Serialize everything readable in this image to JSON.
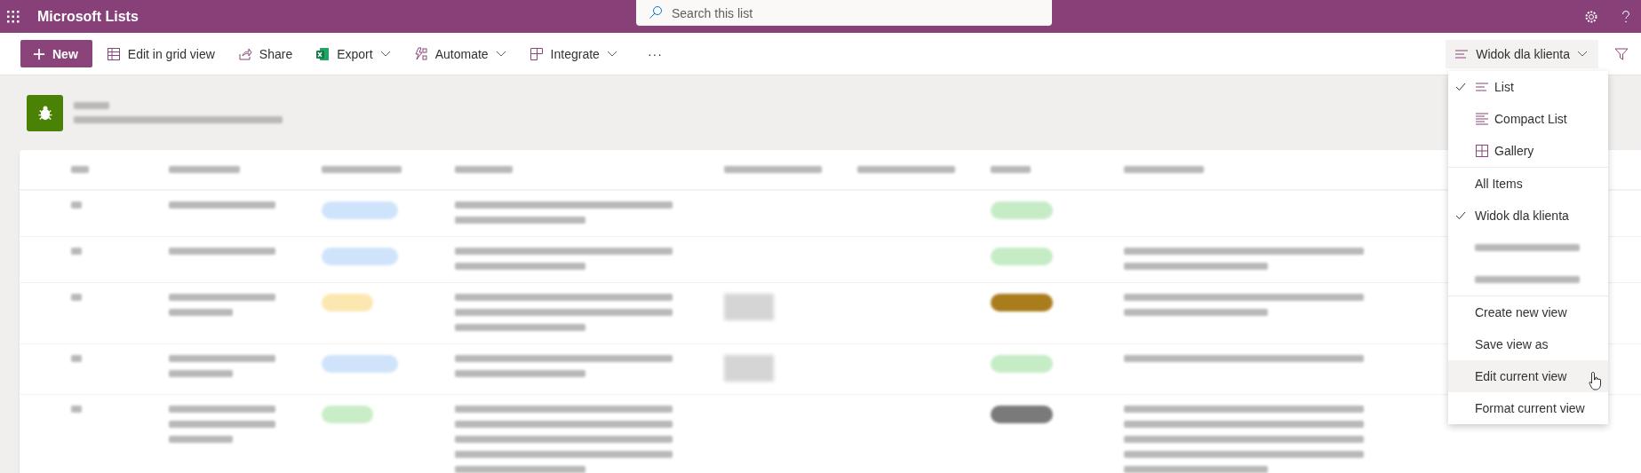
{
  "app_bar": {
    "title": "Microsoft Lists",
    "search": {
      "placeholder": "Search this list"
    }
  },
  "command_bar": {
    "commands": [
      {
        "label": "New",
        "kind": "new",
        "dropdown": false
      },
      {
        "label": "Edit in grid view",
        "kind": "grid",
        "dropdown": false
      },
      {
        "label": "Share",
        "kind": "share",
        "dropdown": false
      },
      {
        "label": "Export",
        "kind": "excel",
        "dropdown": true
      },
      {
        "label": "Automate",
        "kind": "automate",
        "dropdown": true
      },
      {
        "label": "Integrate",
        "kind": "integrate",
        "dropdown": true
      },
      {
        "label": "···",
        "kind": "more",
        "dropdown": false
      }
    ],
    "view_button": {
      "label": "Widok dla klienta"
    }
  },
  "view_menu": {
    "sections": [
      {
        "items": [
          {
            "label": "List",
            "kind": "list",
            "checked": true,
            "hovered": false
          },
          {
            "label": "Compact List",
            "kind": "compact",
            "checked": false,
            "hovered": false
          },
          {
            "label": "Gallery",
            "kind": "gallery",
            "checked": false,
            "hovered": false
          }
        ]
      },
      {
        "items": [
          {
            "label": "All Items",
            "kind": "view",
            "checked": false,
            "hovered": false
          },
          {
            "label": "Widok dla klienta",
            "kind": "view",
            "checked": true,
            "hovered": false
          },
          {
            "kind": "blurred",
            "checked": false,
            "hovered": false
          },
          {
            "kind": "blurred",
            "checked": false,
            "hovered": false
          }
        ]
      },
      {
        "items": [
          {
            "label": "Create new view",
            "kind": "action",
            "checked": false,
            "hovered": false
          },
          {
            "label": "Save view as",
            "kind": "action",
            "checked": false,
            "hovered": false
          },
          {
            "label": "Edit current view",
            "kind": "action",
            "checked": false,
            "hovered": true
          },
          {
            "label": "Format current view",
            "kind": "action",
            "checked": false,
            "hovered": false
          }
        ]
      }
    ]
  },
  "list": {
    "rows": [
      {
        "category_tag": {
          "color": "#cfe4fa"
        },
        "status_tag": {
          "color": "#c6ecc6"
        },
        "thumbnail": false
      },
      {
        "category_tag": {
          "color": "#cfe4fa"
        },
        "status_tag": {
          "color": "#c6ecc6"
        },
        "thumbnail": false
      },
      {
        "category_tag": {
          "color": "#fde7b0"
        },
        "status_tag": {
          "color": "#a97c1c"
        },
        "thumbnail": true
      },
      {
        "category_tag": {
          "color": "#cfe4fa"
        },
        "status_tag": {
          "color": "#c6ecc6"
        },
        "thumbnail": true
      },
      {
        "category_tag": {
          "color": "#c9edc6"
        },
        "status_tag": {
          "color": "#7a7a7a"
        },
        "thumbnail": false
      }
    ]
  }
}
